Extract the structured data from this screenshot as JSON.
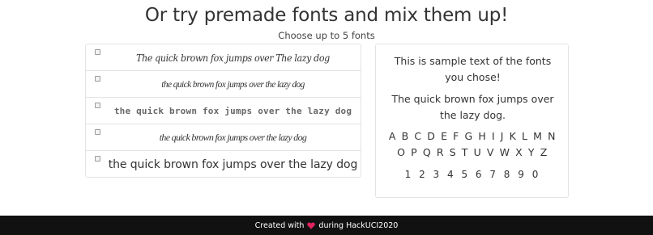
{
  "header": {
    "title": "Or try premade fonts and mix them up!",
    "subtitle": "Choose up to 5 fonts"
  },
  "font_options": [
    {
      "sample": "The quick brown fox jumps over The lazy dog",
      "checked": false
    },
    {
      "sample": "the quick brown fox jumps over the lazy dog",
      "checked": false
    },
    {
      "sample": "the quick brown fox jumps over the lazy dog",
      "checked": false
    },
    {
      "sample": "the quick brown fox jumps over the lazy dog",
      "checked": false
    },
    {
      "sample": "the quick brown fox jumps over the lazy dog",
      "checked": false
    }
  ],
  "preview": {
    "line1": "This is sample text of the fonts you chose!",
    "line2": "The quick brown fox jumps over the lazy dog.",
    "alphabet": "A B C D E F G H I J K L M N O P Q R S T U V W X Y Z",
    "digits": "1 2 3 4 5 6 7 8 9 0"
  },
  "footer": {
    "prefix": "Created with",
    "heart_icon": "heart-icon",
    "heart_color": "#e0245e",
    "suffix": "during HackUCI2020"
  }
}
